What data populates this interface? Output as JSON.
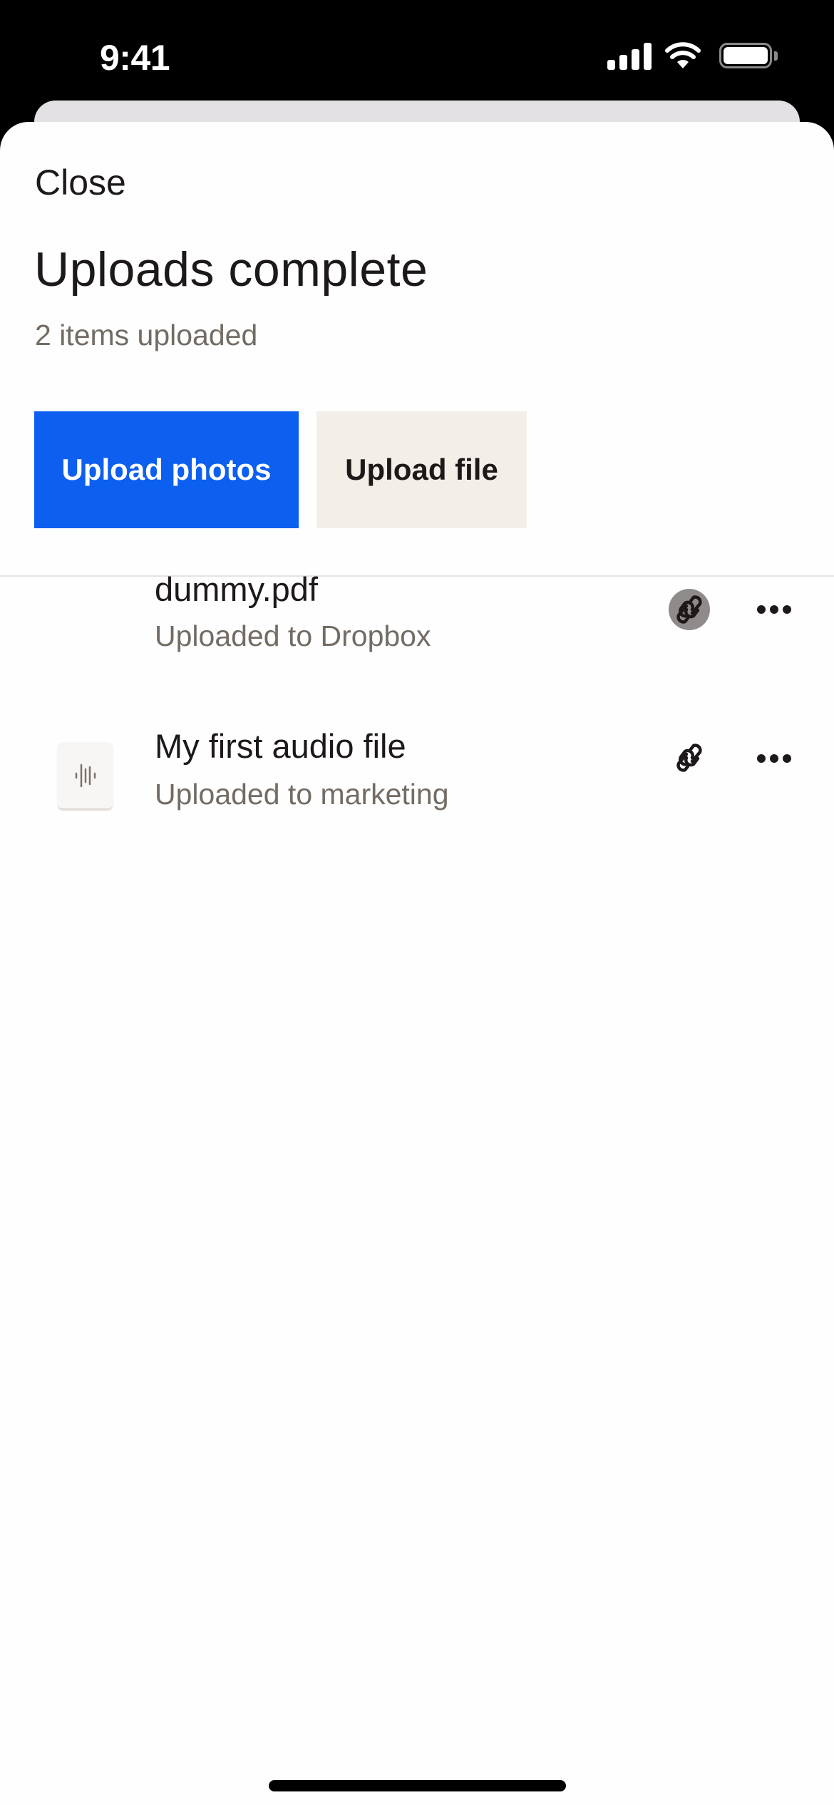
{
  "status_bar": {
    "time": "9:41",
    "icons": [
      "cellular-signal-icon",
      "wifi-icon",
      "battery-icon"
    ]
  },
  "sheet": {
    "close_label": "Close",
    "title": "Uploads complete",
    "subtitle": "2 items uploaded",
    "actions": {
      "primary_label": "Upload photos",
      "secondary_label": "Upload file"
    }
  },
  "uploads": [
    {
      "name": "dummy.pdf",
      "destination": "Uploaded to Dropbox",
      "thumbnail": "none",
      "link_icon": "link-icon",
      "link_pressed": true,
      "more_icon": "more-horizontal-icon"
    },
    {
      "name": "My first audio file",
      "destination": "Uploaded to marketing",
      "thumbnail": "audio-waveform-icon",
      "link_icon": "link-icon",
      "link_pressed": false,
      "more_icon": "more-horizontal-icon"
    }
  ],
  "colors": {
    "primary": "#0d5ff0",
    "secondary_button": "#f3efe8",
    "text": "#1e1919",
    "muted_text": "#736c64",
    "pressed_highlight": "#8f8b8b"
  }
}
